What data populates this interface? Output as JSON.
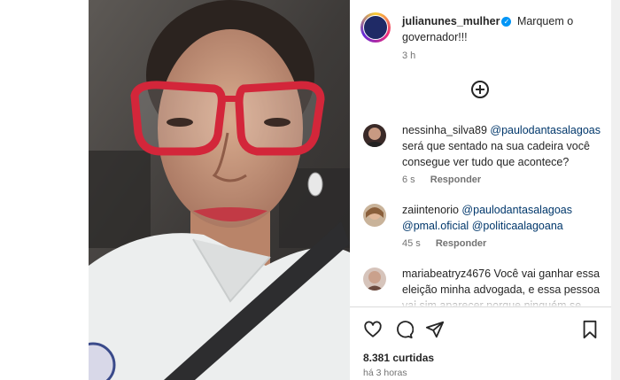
{
  "post": {
    "author": "julianunes_mulher",
    "caption": "Marquem o governador!!!",
    "caption_time": "3 h"
  },
  "comments": [
    {
      "user": "nessinha_silva89",
      "mentions": [
        "@paulodantasalagoas"
      ],
      "text": "será que sentado na sua cadeira você consegue ver tudo que acontece?",
      "time": "6 s",
      "reply": "Responder"
    },
    {
      "user": "zaiintenorio",
      "mentions": [
        "@paulodantasalagoas",
        "@pmal.oficial",
        "@politicaalagoana"
      ],
      "text": "",
      "time": "45 s",
      "reply": "Responder"
    },
    {
      "user": "mariabeatryz4676",
      "mentions": [],
      "text": "Você vai ganhar essa eleição minha advogada, e essa pessoa vai sim aparecer porque ninguém se",
      "time": "",
      "reply": ""
    }
  ],
  "footer": {
    "likes": "8.381 curtidas",
    "time": "há 3 horas"
  },
  "icons": [
    "verified-icon",
    "load-more-plus-icon",
    "heart-icon",
    "comment-icon",
    "share-icon",
    "save-icon"
  ],
  "colors": {
    "link": "#00376b",
    "verified": "#0095f6",
    "muted": "#737373",
    "frame_red": "#d3263a"
  }
}
